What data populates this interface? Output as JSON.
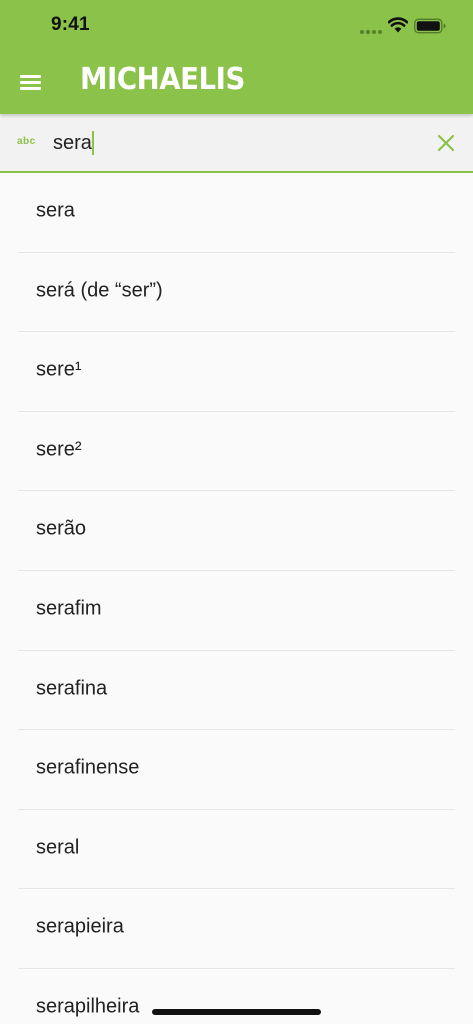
{
  "status_bar": {
    "time": "9:41"
  },
  "header": {
    "logo_text": "MICHAELIS",
    "menu_icon": "hamburger-menu-icon",
    "accent_color": "#8bc24a"
  },
  "search": {
    "mode_label": "abc",
    "query": "sera",
    "clear_icon": "close-icon"
  },
  "results": [
    "sera",
    "será (de “ser”)",
    "sere¹",
    "sere²",
    "serão",
    "serafim",
    "serafina",
    "serafinense",
    "seral",
    "serapieira",
    "serapilheira"
  ]
}
